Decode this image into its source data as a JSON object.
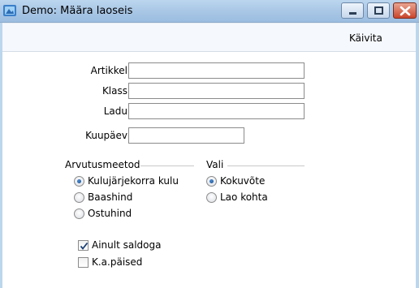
{
  "window": {
    "title": "Demo: Määra laoseis",
    "icon": "app-icon",
    "controls": [
      "minimize-icon",
      "maximize-icon",
      "close-icon"
    ]
  },
  "toolbar": {
    "run_label": "Käivita"
  },
  "form": {
    "fields": [
      {
        "label": "Artikkel",
        "value": ""
      },
      {
        "label": "Klass",
        "value": ""
      },
      {
        "label": "Ladu",
        "value": ""
      },
      {
        "label": "Kuupäev",
        "value": ""
      }
    ]
  },
  "calc_method": {
    "title": "Arvutusmeetod",
    "options": [
      {
        "label": "Kulujärjekorra kulu",
        "selected": true
      },
      {
        "label": "Baashind",
        "selected": false
      },
      {
        "label": "Ostuhind",
        "selected": false
      }
    ]
  },
  "choose": {
    "title": "Vali",
    "options": [
      {
        "label": "Kokuvõte",
        "selected": true
      },
      {
        "label": "Lao kohta",
        "selected": false
      }
    ]
  },
  "checkboxes": [
    {
      "label": "Ainult saldoga",
      "checked": true
    },
    {
      "label": "K.a.päised",
      "checked": false
    }
  ],
  "colors": {
    "titlebar": "#a9c7e6",
    "close_button": "#c9452b",
    "radio_dot": "#1a4e8c"
  }
}
